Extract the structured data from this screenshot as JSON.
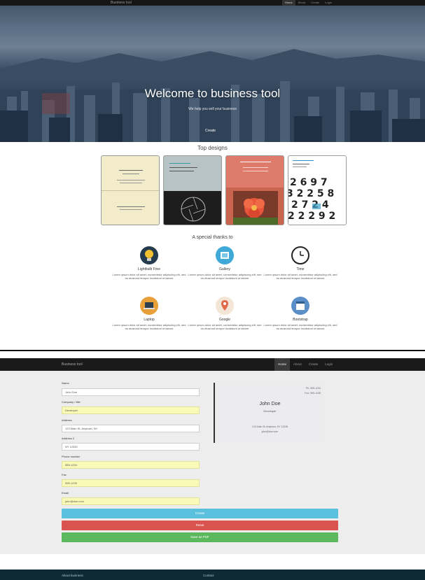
{
  "nav": {
    "brand": "Business tool",
    "items": [
      "Home",
      "About",
      "Create",
      "Login"
    ]
  },
  "hero": {
    "title": "Welcome to business tool",
    "subtitle": "We help you sell your business",
    "button": "Create"
  },
  "designs": {
    "heading": "Top designs",
    "cards": [
      "design-cream",
      "design-gray",
      "design-flower",
      "design-numbers"
    ]
  },
  "thanks": {
    "heading": "A special thanks to",
    "items": [
      {
        "name": "Lightbulb Free",
        "desc": "Lorem ipsum dolor sit amet, consectetur adipiscing elit, sed do eiusmod tempor incididunt ut labore",
        "icon": "lightbulb-icon"
      },
      {
        "name": "Gallery",
        "desc": "Lorem ipsum dolor sit amet, consectetur adipiscing elit, sed do eiusmod tempor incididunt ut labore",
        "icon": "gallery-icon"
      },
      {
        "name": "Time",
        "desc": "Lorem ipsum dolor sit amet, consectetur adipiscing elit, sed do eiusmod tempor incididunt ut labore",
        "icon": "clock-icon"
      },
      {
        "name": "Laptop",
        "desc": "Lorem ipsum dolor sit amet, consectetur adipiscing elit, sed do eiusmod tempor incididunt ut labore",
        "icon": "laptop-icon"
      },
      {
        "name": "Google",
        "desc": "Lorem ipsum dolor sit amet, consectetur adipiscing elit, sed do eiusmod tempor incididunt ut labore",
        "icon": "map-pin-icon"
      },
      {
        "name": "Bootstrap",
        "desc": "Lorem ipsum dolor sit amet, consectetur adipiscing elit, sed do eiusmod tempor incididunt ut labore",
        "icon": "calendar-icon"
      }
    ]
  },
  "app": {
    "brand": "Business tool",
    "nav": [
      "Home",
      "About",
      "Create",
      "Login"
    ],
    "form": {
      "fields": [
        {
          "label": "Name",
          "value": "John Doe",
          "highlight": false
        },
        {
          "label": "Company / title",
          "value": "Developer",
          "highlight": true
        },
        {
          "label": "Address",
          "value": "123 Main St, Anytown, NY",
          "highlight": false
        },
        {
          "label": "Address 2",
          "value": "NY 12345",
          "highlight": false
        },
        {
          "label": "Phone number",
          "value": "555-1234",
          "highlight": true
        },
        {
          "label": "Fax",
          "value": "555-1235",
          "highlight": true
        },
        {
          "label": "Email",
          "value": "john@doe.com",
          "highlight": true
        }
      ]
    },
    "preview": {
      "name": "John Doe",
      "title": "Developer",
      "address1": "123 Main St, Anytown, NY 12345",
      "address2": "john@doe.com",
      "phone": "Ph: 555-1234",
      "email": "Fax: 555-1235"
    },
    "buttons": {
      "create": "Create",
      "reset": "Reset",
      "pdf": "Save as PDF"
    }
  },
  "footer": {
    "left": "About business",
    "right": "Contact"
  },
  "colors": {
    "info": "#5bc0de",
    "danger": "#d9534f",
    "success": "#5cb85c",
    "footer": "#0d2a35"
  }
}
